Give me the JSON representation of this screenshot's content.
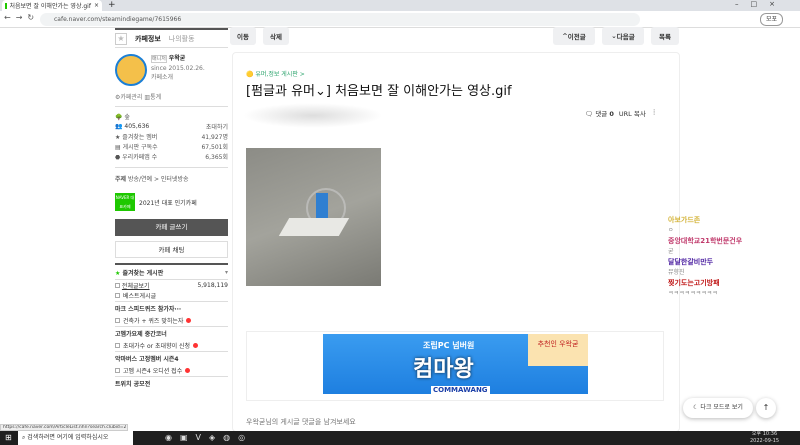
{
  "browser": {
    "tab_title": "처음보면 잘 이해안가는 영상.gif",
    "url": "cafe.naver.com/steamindiegame/7615966",
    "profile_label": "모포"
  },
  "sidebar": {
    "tab_info": "카페정보",
    "tab_activity": "나의활동",
    "manager_badge": "매니저",
    "manager_name": "우왁굳",
    "since": "since 2015.02.26.",
    "intro": "카페소개",
    "manage": "카페관리",
    "stats": "통계",
    "level": "숲",
    "members": "405,636",
    "invite": "초대하기",
    "stats_rows": [
      {
        "label": "즐겨찾는 멤버",
        "value": "41,927명"
      },
      {
        "label": "게시판 구독수",
        "value": "67,501회"
      },
      {
        "label": "우리카페앱 수",
        "value": "6,365회"
      }
    ],
    "topic_label": "주제",
    "topic": "방송/연예 > 인터넷방송",
    "naver_badge": "NAVER 대표카페",
    "award": "2021년 대표 인기카페",
    "write": "카페 글쓰기",
    "chat": "카페 채팅",
    "favorites": "즐겨찾는 게시판",
    "all_posts": "전체글보기",
    "all_count": "5,918,119",
    "best": "베스트게시글",
    "groups": [
      {
        "title": "마크 스피드퀴즈 참가자···",
        "item": "건축가 + 퀴즈 맞히는자"
      },
      {
        "title": "고멤가요제 중간코너",
        "item": "초대가수 or 초대향이 신청"
      },
      {
        "title": "악마버스 고정멤버 시즌4",
        "item": "고멤 시즌4 오디션 접수"
      },
      {
        "title": "트위치 공모전",
        "item": ""
      }
    ]
  },
  "toolbar": {
    "move": "이동",
    "delete": "삭제",
    "prev": "이전글",
    "next": "다음글",
    "list": "목록"
  },
  "article": {
    "board": "유머,정보 게시판 >",
    "title": "[펌글과 유머⌄] 처음보면 잘 이해안가는 영상.gif",
    "comments_label": "댓글",
    "comments": "0",
    "url_copy": "URL 복사",
    "ad_top": "조립PC 넘버원",
    "ad_main": "컴마왕",
    "ad_badge": "추천인 우왁굳",
    "ad_brand": "COMMAWANG",
    "comment_prompt": "우왁굳님의 게시글 댓글을 남겨보세요"
  },
  "chat": [
    {
      "name": "아보가드존",
      "msg": "ㅇ",
      "color": "#d4b43a"
    },
    {
      "name": "중앙대학교21학번문건우",
      "msg": "굳",
      "color": "#c0396b"
    },
    {
      "name": "달달한갈비만두",
      "msg": "뮤향진",
      "color": "#4a1ea0"
    },
    {
      "name": "찢기도는고기방패",
      "msg": "ㅋㅋㅋㅋㅋㅋㅋㅋㅋ",
      "color": "#c01818"
    }
  ],
  "float": {
    "dark_mode": "다크 모드로 보기"
  },
  "status_url": "https://cafe.naver.com/ArticleList.nhn?search.clubid=27842958&search.boardtype=L",
  "taskbar": {
    "search": "검색하려면 여기에 입력하십시오",
    "time": "오후 10:36",
    "date": "2022-09-15"
  }
}
